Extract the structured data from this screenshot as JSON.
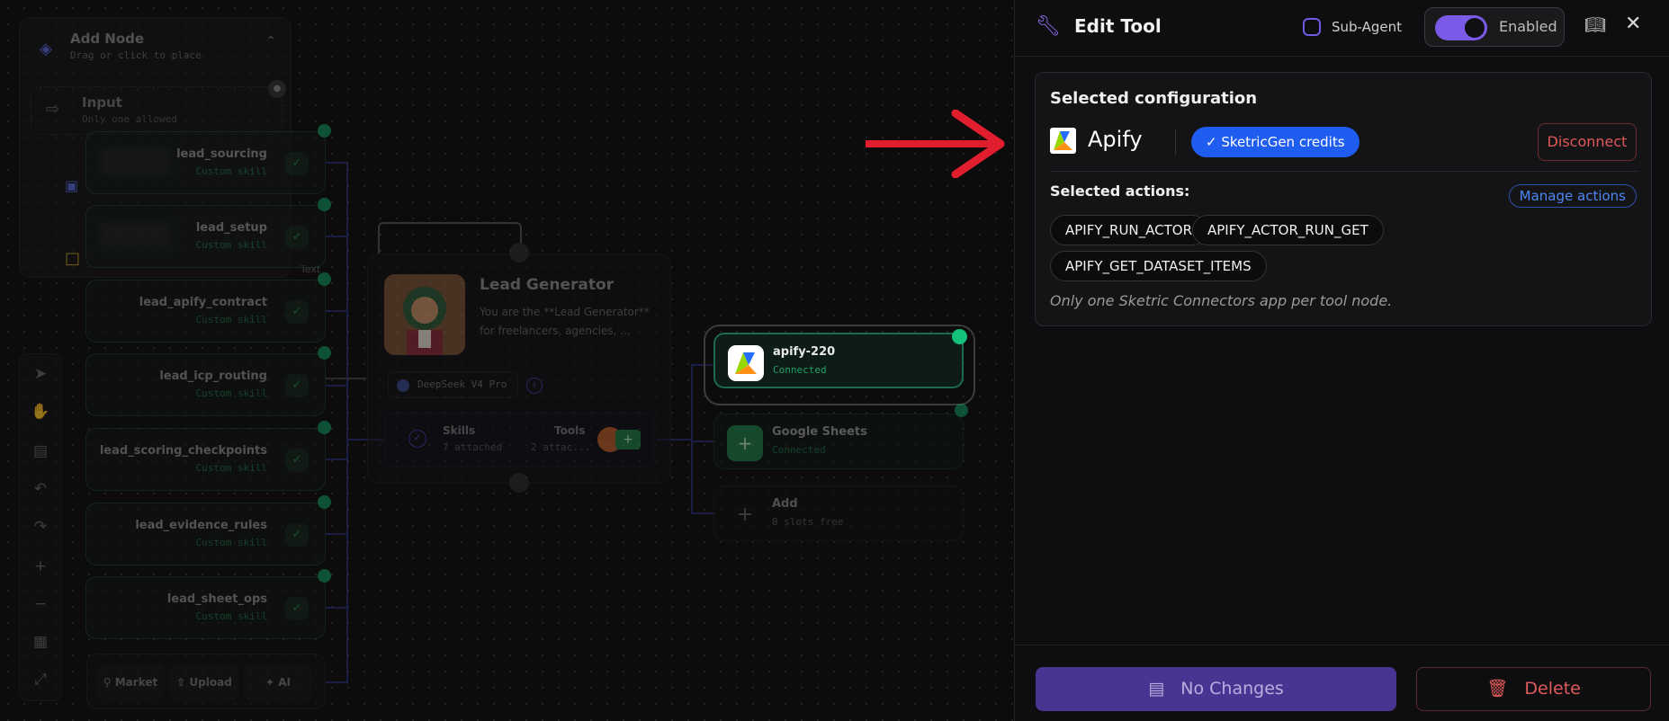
{
  "canvas": {
    "palette": {
      "title": "Add Node",
      "subtitle": "Drag or click to place",
      "input_title": "Input",
      "input_sub": "Only one allowed"
    },
    "text_label": "Text",
    "skills": [
      {
        "name": "lead_sourcing",
        "sub": "Custom skill"
      },
      {
        "name": "lead_setup",
        "sub": "Custom skill"
      },
      {
        "name": "lead_apify_contract",
        "sub": "Custom skill"
      },
      {
        "name": "lead_icp_routing",
        "sub": "Custom skill"
      },
      {
        "name": "lead_scoring_checkpoints",
        "sub": "Custom skill"
      },
      {
        "name": "lead_evidence_rules",
        "sub": "Custom skill"
      },
      {
        "name": "lead_sheet_ops",
        "sub": "Custom skill"
      }
    ],
    "agent": {
      "title": "Lead Generator",
      "description": "You are the **Lead Generator** for freelancers, agencies, ...",
      "model": "DeepSeek V4 Pro",
      "skills_label": "Skills",
      "skills_count": "7 attached",
      "tools_label": "Tools",
      "tools_count": "2 attac..."
    },
    "tools": [
      {
        "name": "apify-220",
        "status": "Connected"
      },
      {
        "name": "Google Sheets",
        "status": "Connected"
      },
      {
        "name": "Add",
        "status": "8 slots free"
      }
    ],
    "bottom_bar": {
      "market": "Market",
      "upload": "Upload",
      "ai": "AI"
    }
  },
  "panel": {
    "title": "Edit Tool",
    "sub_agent_label": "Sub-Agent",
    "enabled_label": "Enabled",
    "config_title": "Selected configuration",
    "app_name": "Apify",
    "credits_label": "✓ SketricGen credits",
    "disconnect_label": "Disconnect",
    "actions_label": "Selected actions:",
    "manage_label": "Manage actions",
    "actions": [
      "APIFY_RUN_ACTOR",
      "APIFY_ACTOR_RUN_GET",
      "APIFY_GET_DATASET_ITEMS"
    ],
    "note": "Only one Sketric Connectors app per tool node.",
    "save_label": "No Changes",
    "delete_label": "Delete"
  },
  "colors": {
    "accent": "#7a5ae6",
    "credits": "#1f5cf0",
    "danger": "#e05a5a",
    "connected": "#14c07a"
  }
}
